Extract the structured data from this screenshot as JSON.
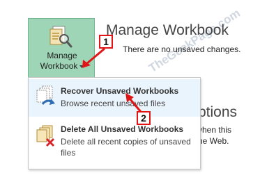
{
  "manage_button": {
    "label_line1": "Manage",
    "label_line2": "Workbook",
    "color": "#9fd5b7"
  },
  "section": {
    "title": "Manage Workbook",
    "info": "There are no unsaved changes."
  },
  "background_text": {
    "options_fragment": "ptions",
    "line1_fragment": "vhen this",
    "line2_fragment": "he Web."
  },
  "menu": {
    "items": [
      {
        "title": "Recover Unsaved Workbooks",
        "description": "Browse recent unsaved files",
        "icon": "recover-workbooks-icon"
      },
      {
        "title": "Delete All Unsaved Workbooks",
        "description": "Delete all recent copies of unsaved files",
        "icon": "delete-workbooks-icon"
      }
    ]
  },
  "callouts": {
    "step1": "1",
    "step2": "2",
    "color": "#e11515"
  },
  "watermark": "TheGeekPage.com"
}
